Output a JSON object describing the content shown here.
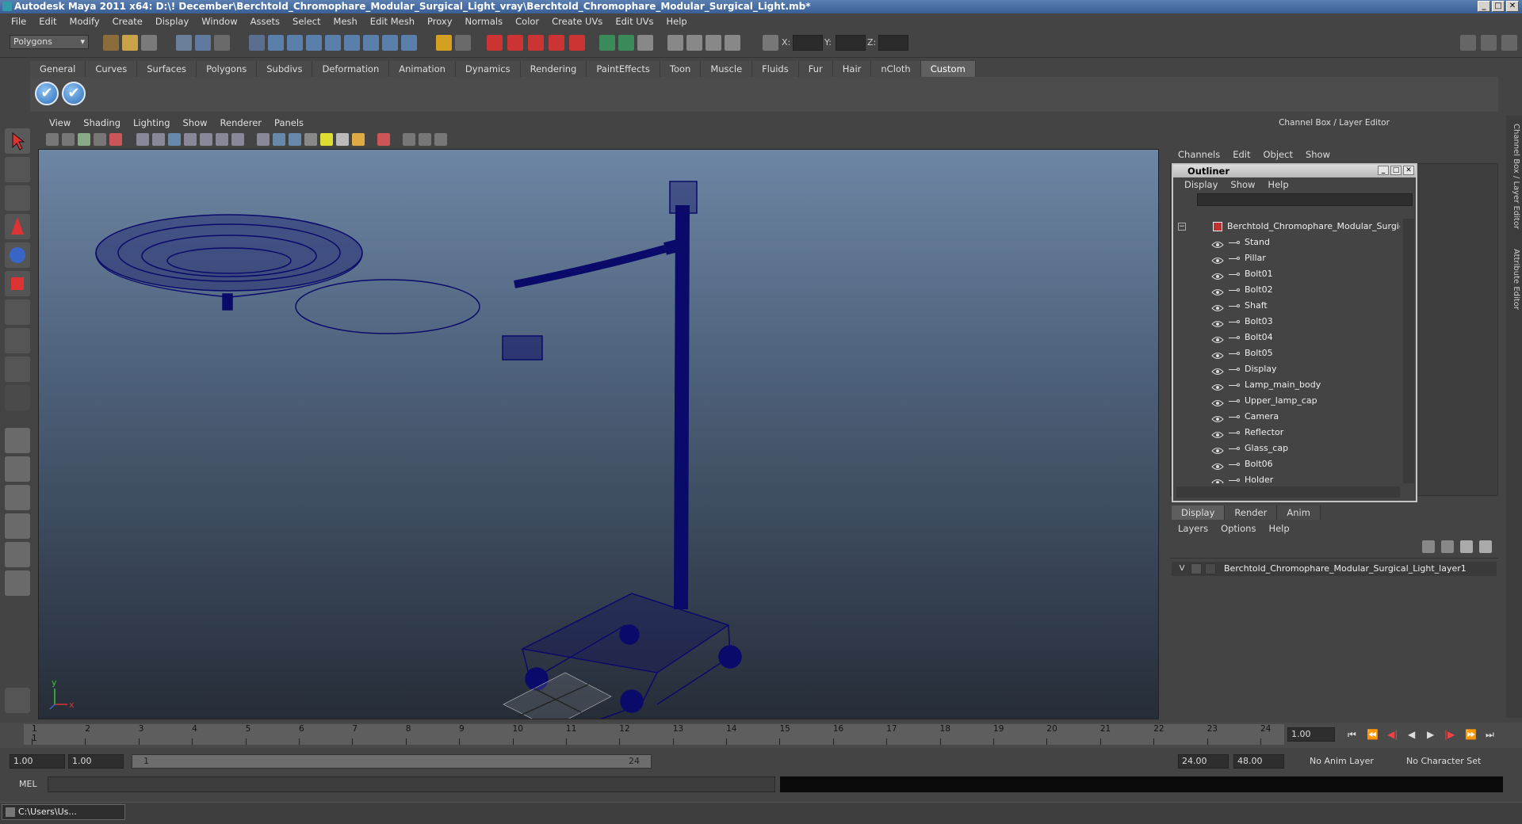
{
  "window": {
    "title": "Autodesk Maya 2011 x64: D:\\! December\\Berchtold_Chromophare_Modular_Surgical_Light_vray\\Berchtold_Chromophare_Modular_Surgical_Light.mb*",
    "min": "_",
    "max": "□",
    "close": "✕"
  },
  "menubar": [
    "File",
    "Edit",
    "Modify",
    "Create",
    "Display",
    "Window",
    "Assets",
    "Select",
    "Mesh",
    "Edit Mesh",
    "Proxy",
    "Normals",
    "Color",
    "Create UVs",
    "Edit UVs",
    "Help"
  ],
  "statusline": {
    "mode": "Polygons",
    "x_label": "X:",
    "y_label": "Y:",
    "z_label": "Z:"
  },
  "shelf": {
    "tabs": [
      "General",
      "Curves",
      "Surfaces",
      "Polygons",
      "Subdivs",
      "Deformation",
      "Animation",
      "Dynamics",
      "Rendering",
      "PaintEffects",
      "Toon",
      "Muscle",
      "Fluids",
      "Fur",
      "Hair",
      "nCloth",
      "Custom"
    ],
    "active_tab": "Custom",
    "button_glyph": "✔"
  },
  "viewport": {
    "menu": [
      "View",
      "Shading",
      "Lighting",
      "Show",
      "Renderer",
      "Panels"
    ],
    "axis_x": "x",
    "axis_y": "y",
    "wire_color": "#0a0a6a"
  },
  "channelbox": {
    "title": "Channel Box / Layer Editor",
    "menu": [
      "Channels",
      "Edit",
      "Object",
      "Show"
    ]
  },
  "outliner": {
    "title": "Outliner",
    "min": "_",
    "max": "□",
    "close": "✕",
    "menu": [
      "Display",
      "Show",
      "Help"
    ],
    "root": "Berchtold_Chromophare_Modular_Surgical_L",
    "items": [
      "Stand",
      "Pillar",
      "Bolt01",
      "Bolt02",
      "Shaft",
      "Bolt03",
      "Bolt04",
      "Bolt05",
      "Display",
      "Lamp_main_body",
      "Upper_lamp_cap",
      "Camera",
      "Reflector",
      "Glass_cap",
      "Bolt06",
      "Holder"
    ]
  },
  "layereditor": {
    "tabs": [
      "Display",
      "Render",
      "Anim"
    ],
    "active_tab": "Display",
    "menu": [
      "Layers",
      "Options",
      "Help"
    ],
    "layer_visibility": "V",
    "layer_name": "Berchtold_Chromophare_Modular_Surgical_Light_layer1"
  },
  "sidetabs": [
    "Channel Box / Layer Editor",
    "Attribute Editor"
  ],
  "timeline": {
    "ticks": [
      "1",
      "2",
      "3",
      "4",
      "5",
      "6",
      "7",
      "8",
      "9",
      "10",
      "11",
      "12",
      "13",
      "14",
      "15",
      "16",
      "17",
      "18",
      "19",
      "20",
      "21",
      "22",
      "23",
      "24"
    ],
    "current_frame": "1.00",
    "frame_marker": "1"
  },
  "range": {
    "start": "1.00",
    "playback_start": "1.00",
    "slider_start": "1",
    "slider_end": "24",
    "playback_end": "24.00",
    "end": "48.00",
    "anim_layer": "No Anim Layer",
    "character_set": "No Character Set"
  },
  "cmdline": {
    "label": "MEL"
  },
  "taskbar": {
    "label": "C:\\Users\\Us..."
  }
}
